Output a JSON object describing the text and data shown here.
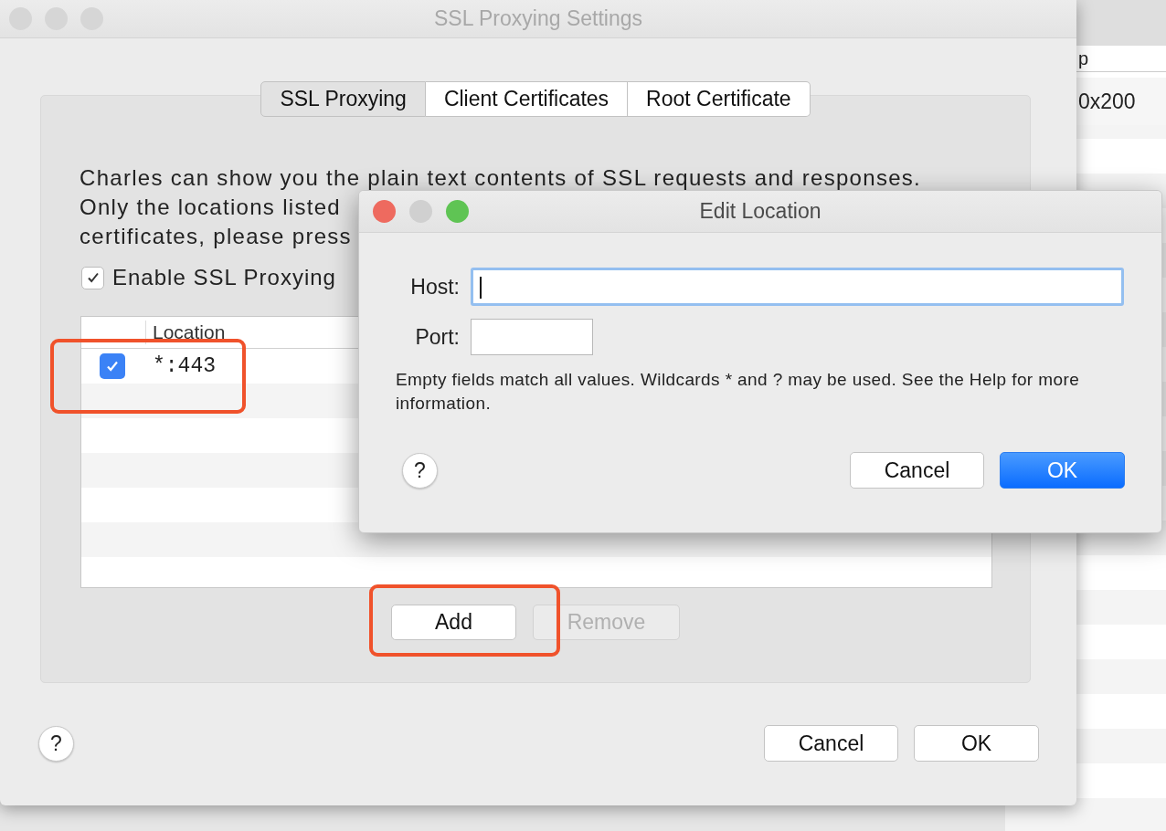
{
  "background_app": {
    "header_fragment": "p",
    "cell_fragment": "0x200"
  },
  "main_window": {
    "title": "SSL Proxying Settings",
    "traffic_lights": [
      {
        "color": "#d6d6d6"
      },
      {
        "color": "#d6d6d6"
      },
      {
        "color": "#d6d6d6"
      }
    ],
    "tabs": [
      {
        "label": "SSL Proxying",
        "selected": true
      },
      {
        "label": "Client Certificates",
        "selected": false
      },
      {
        "label": "Root Certificate",
        "selected": false
      }
    ],
    "description_lines": [
      "Charles can show you the plain text contents of SSL requests and responses.",
      "Only the locations listed",
      "certificates, please press"
    ],
    "enable_ssl": {
      "label": "Enable SSL Proxying",
      "checked": true
    },
    "table": {
      "columns": [
        "Location"
      ],
      "rows": [
        {
          "enabled": true,
          "location": "*:443"
        }
      ]
    },
    "buttons": [
      {
        "label": "Add",
        "disabled": false
      },
      {
        "label": "Remove",
        "disabled": true
      }
    ],
    "help_label": "?",
    "footer_buttons": [
      {
        "label": "Cancel",
        "default": false
      },
      {
        "label": "OK",
        "default": false
      }
    ]
  },
  "dialog": {
    "title": "Edit Location",
    "traffic_lights": [
      {
        "color": "#ee6a5f"
      },
      {
        "color": "#d0d0d0"
      },
      {
        "color": "#5fc454"
      }
    ],
    "fields": [
      {
        "label": "Host:",
        "focused": true
      },
      {
        "label": "Port:",
        "focused": false
      }
    ],
    "note": "Empty fields match all values. Wildcards * and ? may be used. See the Help for more information.",
    "help_label": "?",
    "buttons": [
      {
        "label": "Cancel",
        "default": false
      },
      {
        "label": "OK",
        "default": true
      }
    ]
  }
}
